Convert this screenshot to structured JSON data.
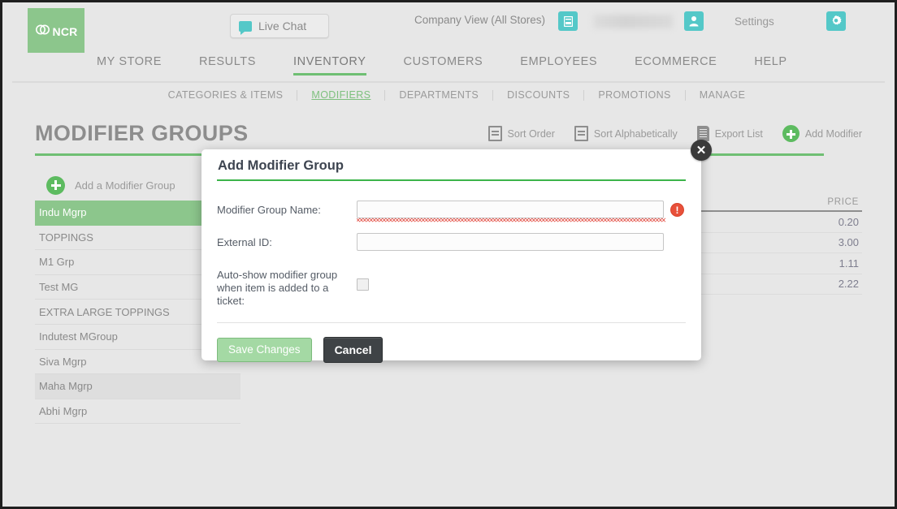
{
  "brand": {
    "logo_text": "NCR",
    "logo_color": "#8cc68c"
  },
  "topbar": {
    "live_chat_label": "Live Chat",
    "company_view_label": "Company View (All Stores)",
    "settings_label": "Settings",
    "store_icon": "store-icon",
    "user_icon": "user-icon",
    "gear_icon": "gear-icon",
    "accent_color": "#54c8c8"
  },
  "mainnav": {
    "items": [
      {
        "label": "MY STORE",
        "active": false
      },
      {
        "label": "RESULTS",
        "active": false
      },
      {
        "label": "INVENTORY",
        "active": true
      },
      {
        "label": "CUSTOMERS",
        "active": false
      },
      {
        "label": "EMPLOYEES",
        "active": false
      },
      {
        "label": "ECOMMERCE",
        "active": false
      },
      {
        "label": "HELP",
        "active": false
      }
    ]
  },
  "subnav": {
    "items": [
      {
        "label": "CATEGORIES & ITEMS",
        "active": false
      },
      {
        "label": "MODIFIERS",
        "active": true
      },
      {
        "label": "DEPARTMENTS",
        "active": false
      },
      {
        "label": "DISCOUNTS",
        "active": false
      },
      {
        "label": "PROMOTIONS",
        "active": false
      },
      {
        "label": "MANAGE",
        "active": false
      }
    ]
  },
  "page": {
    "title": "MODIFIER GROUPS",
    "accent_color": "#6fbf73"
  },
  "toolbar": {
    "sort_order_label": "Sort Order",
    "sort_alphabetically_label": "Sort Alphabetically",
    "export_list_label": "Export List",
    "add_modifier_label": "Add Modifier"
  },
  "modifier_groups": {
    "add_label": "Add a Modifier Group",
    "items": [
      {
        "label": "Indu Mgrp",
        "state": "selected"
      },
      {
        "label": "TOPPINGS",
        "state": "normal"
      },
      {
        "label": "M1 Grp",
        "state": "normal"
      },
      {
        "label": "Test MG",
        "state": "normal"
      },
      {
        "label": "EXTRA LARGE TOPPINGS",
        "state": "normal"
      },
      {
        "label": "Indutest MGroup",
        "state": "normal"
      },
      {
        "label": "Siva Mgrp",
        "state": "normal"
      },
      {
        "label": "Maha Mgrp",
        "state": "hover"
      },
      {
        "label": "Abhi Mgrp",
        "state": "normal"
      }
    ]
  },
  "price_table": {
    "header": "PRICE",
    "rows": [
      "0.20",
      "3.00",
      "1.11",
      "2.22"
    ]
  },
  "modal": {
    "title": "Add Modifier Group",
    "close_label": "✕",
    "name_label": "Modifier Group Name:",
    "name_value": "",
    "name_placeholder": "",
    "name_has_error": true,
    "error_icon_glyph": "!",
    "external_id_label": "External ID:",
    "external_id_value": "",
    "external_id_placeholder": "",
    "autoshow_label": "Auto-show modifier group when item is added to a ticket:",
    "autoshow_checked": false,
    "save_label": "Save Changes",
    "save_disabled": true,
    "cancel_label": "Cancel",
    "rule_color": "#3cb44a"
  }
}
